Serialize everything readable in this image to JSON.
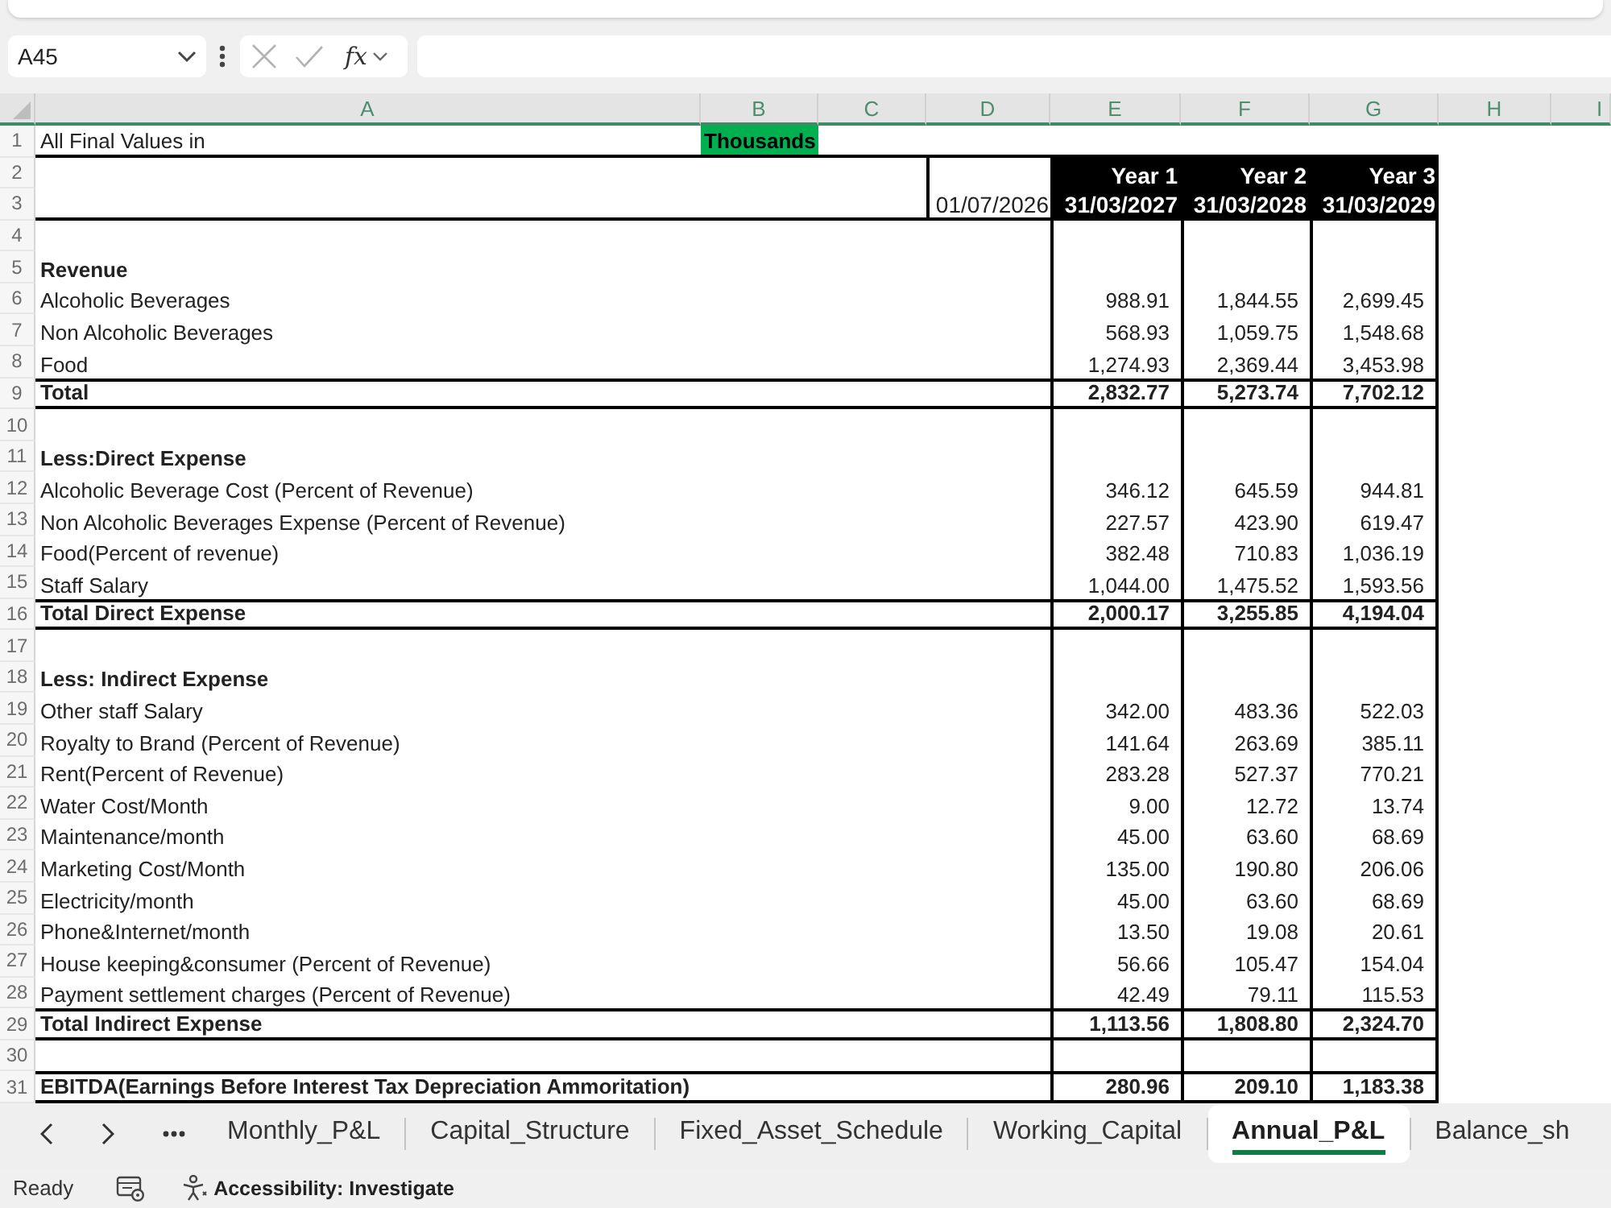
{
  "formula_bar": {
    "name_box": "A45",
    "function_label": "fx"
  },
  "columns": [
    "A",
    "B",
    "C",
    "D",
    "E",
    "F",
    "G",
    "H",
    "I"
  ],
  "rows": [
    {
      "number": "1",
      "kind": "title",
      "label": "All Final Values in",
      "unit": "Thousands"
    },
    {
      "number": "2",
      "kind": "header",
      "values": [
        "Year 1",
        "Year 2",
        "Year 3"
      ]
    },
    {
      "number": "3",
      "kind": "header",
      "start_date": "01/07/2026",
      "values": [
        "31/03/2027",
        "31/03/2028",
        "31/03/2029"
      ]
    },
    {
      "number": "4",
      "kind": "blank"
    },
    {
      "number": "5",
      "kind": "heading",
      "label": "Revenue"
    },
    {
      "number": "6",
      "kind": "item",
      "label": "Alcoholic Beverages",
      "values": [
        "988.91",
        "1,844.55",
        "2,699.45"
      ]
    },
    {
      "number": "7",
      "kind": "item",
      "label": "Non Alcoholic Beverages",
      "values": [
        "568.93",
        "1,059.75",
        "1,548.68"
      ]
    },
    {
      "number": "8",
      "kind": "item",
      "label": "Food",
      "values": [
        "1,274.93",
        "2,369.44",
        "3,453.98"
      ]
    },
    {
      "number": "9",
      "kind": "total",
      "label": "Total",
      "values": [
        "2,832.77",
        "5,273.74",
        "7,702.12"
      ]
    },
    {
      "number": "10",
      "kind": "blank"
    },
    {
      "number": "11",
      "kind": "heading",
      "label": "Less:Direct Expense"
    },
    {
      "number": "12",
      "kind": "item",
      "label": "Alcoholic Beverage Cost (Percent of Revenue)",
      "values": [
        "346.12",
        "645.59",
        "944.81"
      ]
    },
    {
      "number": "13",
      "kind": "item",
      "label": "Non Alcoholic Beverages Expense (Percent of Revenue)",
      "values": [
        "227.57",
        "423.90",
        "619.47"
      ]
    },
    {
      "number": "14",
      "kind": "item",
      "label": "Food(Percent of revenue)",
      "values": [
        "382.48",
        "710.83",
        "1,036.19"
      ]
    },
    {
      "number": "15",
      "kind": "item",
      "label": "Staff Salary",
      "values": [
        "1,044.00",
        "1,475.52",
        "1,593.56"
      ]
    },
    {
      "number": "16",
      "kind": "total",
      "label": "Total Direct Expense",
      "values": [
        "2,000.17",
        "3,255.85",
        "4,194.04"
      ]
    },
    {
      "number": "17",
      "kind": "blank"
    },
    {
      "number": "18",
      "kind": "heading",
      "label": "Less: Indirect Expense"
    },
    {
      "number": "19",
      "kind": "item",
      "label": "Other staff Salary",
      "values": [
        "342.00",
        "483.36",
        "522.03"
      ]
    },
    {
      "number": "20",
      "kind": "item",
      "label": "Royalty to Brand (Percent of Revenue)",
      "values": [
        "141.64",
        "263.69",
        "385.11"
      ]
    },
    {
      "number": "21",
      "kind": "item",
      "label": "Rent(Percent of Revenue)",
      "values": [
        "283.28",
        "527.37",
        "770.21"
      ]
    },
    {
      "number": "22",
      "kind": "item",
      "label": "Water Cost/Month",
      "values": [
        "9.00",
        "12.72",
        "13.74"
      ]
    },
    {
      "number": "23",
      "kind": "item",
      "label": "Maintenance/month",
      "values": [
        "45.00",
        "63.60",
        "68.69"
      ]
    },
    {
      "number": "24",
      "kind": "item",
      "label": "Marketing Cost/Month",
      "values": [
        "135.00",
        "190.80",
        "206.06"
      ]
    },
    {
      "number": "25",
      "kind": "item",
      "label": "Electricity/month",
      "values": [
        "45.00",
        "63.60",
        "68.69"
      ]
    },
    {
      "number": "26",
      "kind": "item",
      "label": "Phone&Internet/month",
      "values": [
        "13.50",
        "19.08",
        "20.61"
      ]
    },
    {
      "number": "27",
      "kind": "item",
      "label": "House keeping&consumer (Percent of Revenue)",
      "values": [
        "56.66",
        "105.47",
        "154.04"
      ]
    },
    {
      "number": "28",
      "kind": "item",
      "label": "Payment settlement charges (Percent of Revenue)",
      "values": [
        "42.49",
        "79.11",
        "115.53"
      ]
    },
    {
      "number": "29",
      "kind": "total",
      "label": "Total Indirect Expense",
      "values": [
        "1,113.56",
        "1,808.80",
        "2,324.70"
      ]
    },
    {
      "number": "30",
      "kind": "blank"
    },
    {
      "number": "31",
      "kind": "total",
      "label": "EBITDA(Earnings Before Interest Tax Depreciation Ammoritation)",
      "values": [
        "280.96",
        "209.10",
        "1,183.38"
      ]
    }
  ],
  "tabs": [
    {
      "label": "Monthly_P&L",
      "selected": false
    },
    {
      "label": "Capital_Structure",
      "selected": false
    },
    {
      "label": "Fixed_Asset_Schedule",
      "selected": false
    },
    {
      "label": "Working_Capital",
      "selected": false
    },
    {
      "label": "Annual_P&L",
      "selected": true
    },
    {
      "label": "Balance_sh",
      "selected": false
    }
  ],
  "status_bar": {
    "mode": "Ready",
    "accessibility": "Accessibility: Investigate"
  }
}
